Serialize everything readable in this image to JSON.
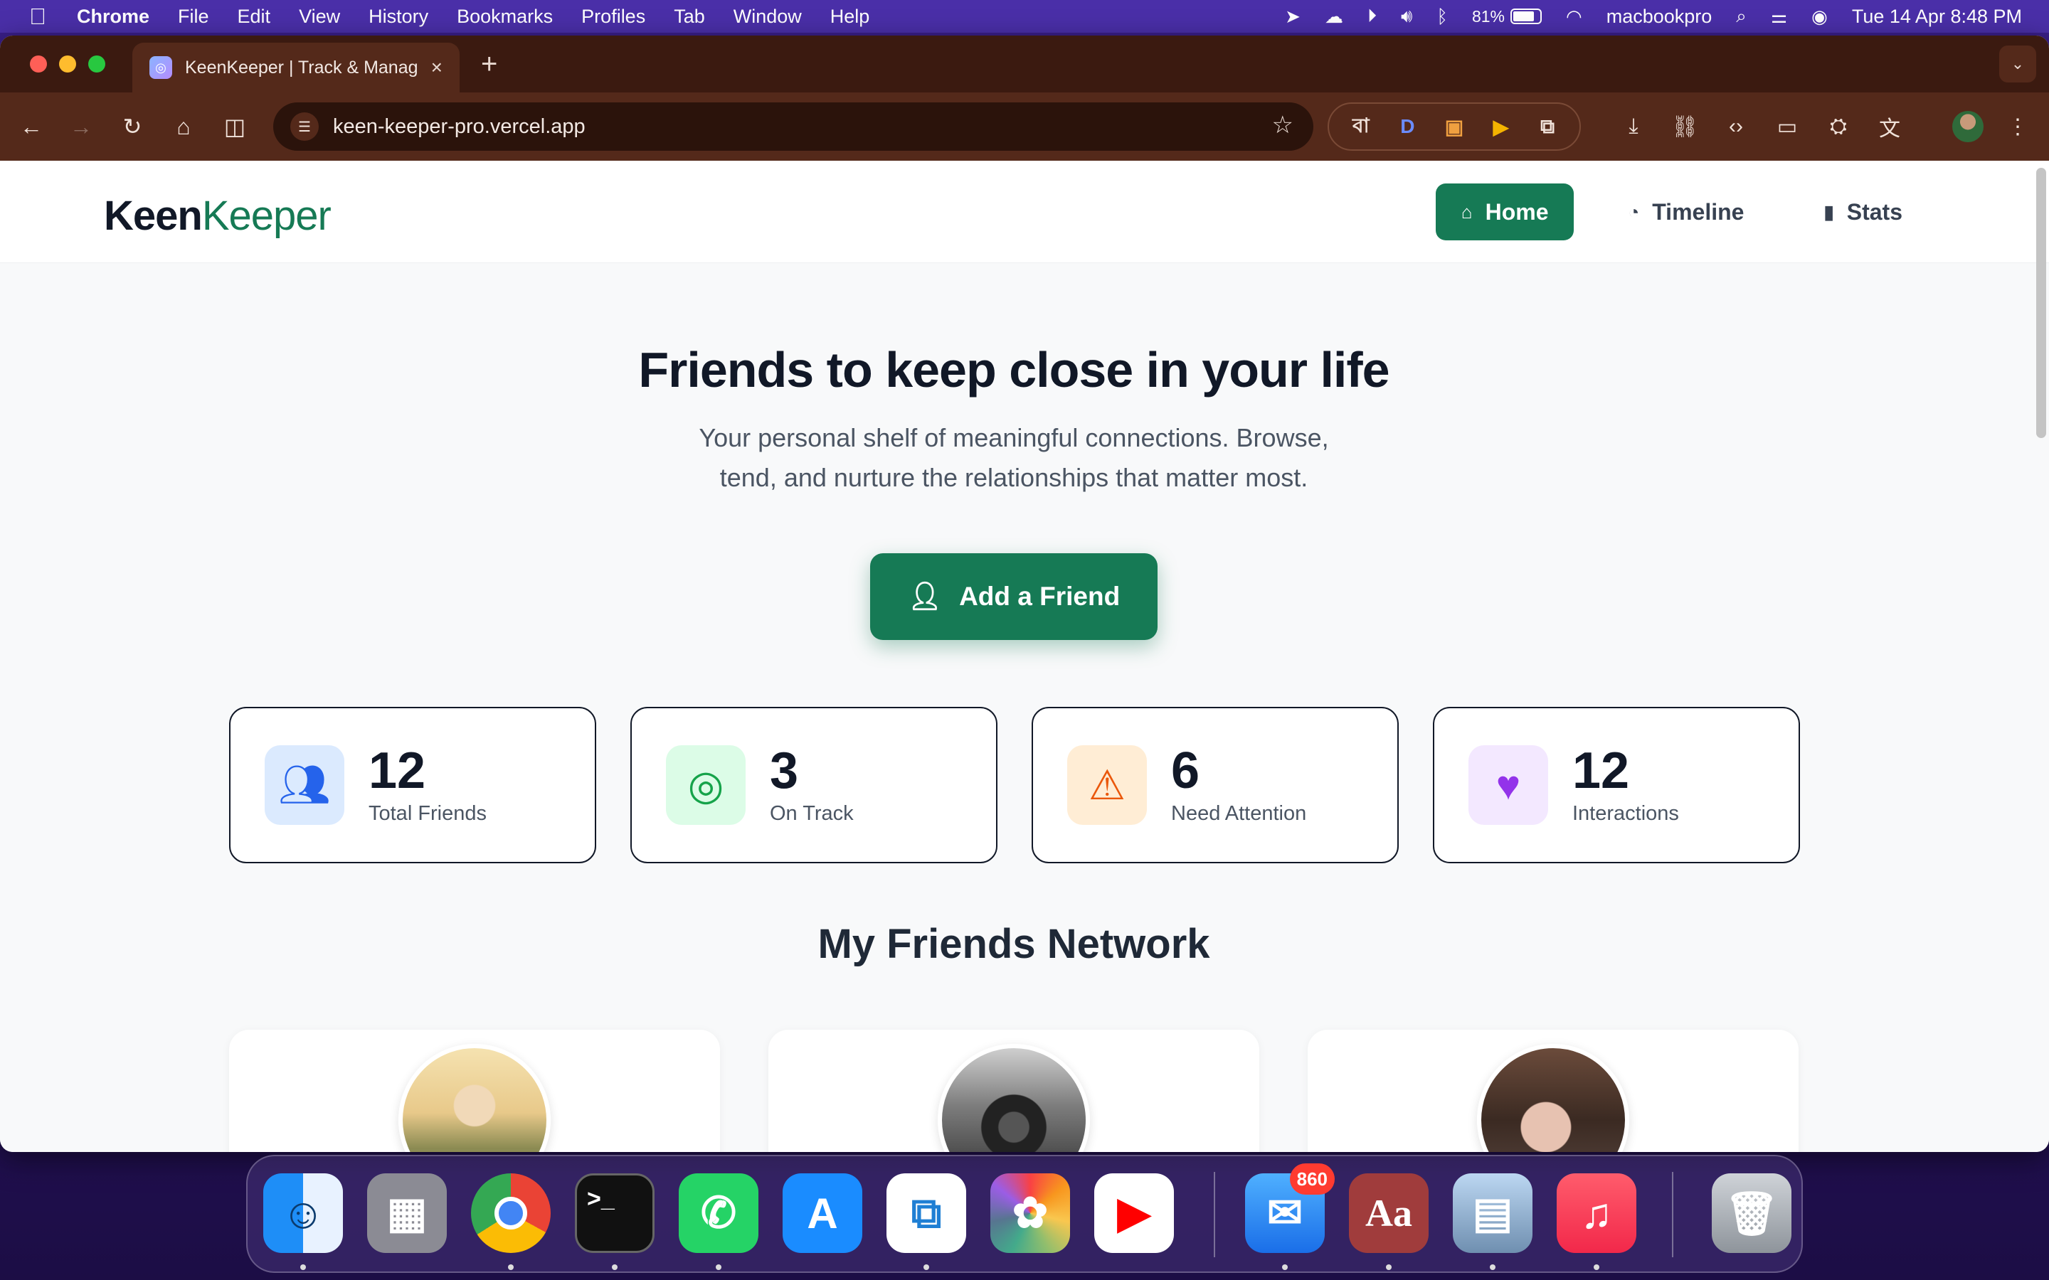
{
  "menubar": {
    "app_name": "Chrome",
    "menus": [
      "File",
      "Edit",
      "View",
      "History",
      "Bookmarks",
      "Profiles",
      "Tab",
      "Window",
      "Help"
    ],
    "battery_percent": "81%",
    "battery_level": 0.81,
    "hostname": "macbookpro",
    "datetime": "Tue 14 Apr  8:48 PM"
  },
  "browser": {
    "tab_title": "KeenKeeper | Track & Manage",
    "url": "keen-keeper-pro.vercel.app",
    "extensions": [
      "বা",
      "D",
      "▣",
      "▶",
      "⧉"
    ]
  },
  "site": {
    "logo_part1": "Keen",
    "logo_part2": "Keeper",
    "nav": [
      {
        "label": "Home",
        "icon": "home-icon",
        "active": true
      },
      {
        "label": "Timeline",
        "icon": "clock-icon",
        "active": false
      },
      {
        "label": "Stats",
        "icon": "bar-chart-icon",
        "active": false
      }
    ],
    "hero_title": "Friends to keep close in your life",
    "hero_subtitle": "Your personal shelf of meaningful connections. Browse, tend, and nurture the relationships that matter most.",
    "add_button": "Add a Friend",
    "stats": [
      {
        "value": "12",
        "label": "Total Friends",
        "icon": "users-icon",
        "icon_bg": "#dbeafe",
        "icon_color": "#2563eb"
      },
      {
        "value": "3",
        "label": "On Track",
        "icon": "target-icon",
        "icon_bg": "#dcfce7",
        "icon_color": "#16a34a"
      },
      {
        "value": "6",
        "label": "Need Attention",
        "icon": "warning-icon",
        "icon_bg": "#ffedd5",
        "icon_color": "#ea580c"
      },
      {
        "value": "12",
        "label": "Interactions",
        "icon": "heart-icon",
        "icon_bg": "#f3e8ff",
        "icon_color": "#9333ea"
      }
    ],
    "section_title": "My Friends Network"
  },
  "dock": {
    "mail_badge": "860",
    "apps": [
      "Finder",
      "Launchpad",
      "Chrome",
      "Terminal",
      "WhatsApp",
      "App Store",
      "VS Code",
      "Photos",
      "YouTube",
      "Mail",
      "Dictionary",
      "Preview",
      "Music",
      "Trash"
    ]
  },
  "colors": {
    "brand_green": "#167a55",
    "text_dark": "#111827"
  }
}
